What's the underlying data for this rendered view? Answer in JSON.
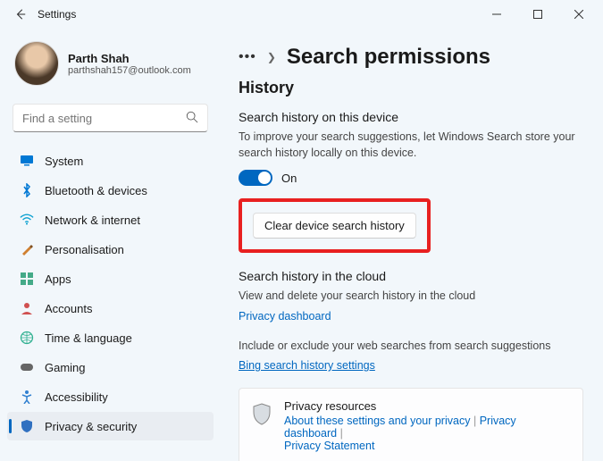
{
  "window": {
    "title": "Settings"
  },
  "profile": {
    "name": "Parth Shah",
    "email": "parthshah157@outlook.com"
  },
  "search": {
    "placeholder": "Find a setting"
  },
  "sidebar": {
    "items": [
      {
        "label": "System"
      },
      {
        "label": "Bluetooth & devices"
      },
      {
        "label": "Network & internet"
      },
      {
        "label": "Personalisation"
      },
      {
        "label": "Apps"
      },
      {
        "label": "Accounts"
      },
      {
        "label": "Time & language"
      },
      {
        "label": "Gaming"
      },
      {
        "label": "Accessibility"
      },
      {
        "label": "Privacy & security"
      }
    ]
  },
  "page": {
    "title": "Search permissions",
    "history_heading": "History",
    "device_heading": "Search history on this device",
    "device_desc": "To improve your search suggestions, let Windows Search store your search history locally on this device.",
    "toggle_state": "On",
    "clear_button": "Clear device search history",
    "cloud_heading": "Search history in the cloud",
    "cloud_desc": "View and delete your search history in the cloud",
    "privacy_dashboard": "Privacy dashboard",
    "include_desc": "Include or exclude your web searches from search suggestions",
    "bing_link": "Bing search history settings",
    "card_title": "Privacy resources",
    "card_link1": "About these settings and your privacy",
    "card_link2": "Privacy dashboard",
    "card_link3": "Privacy Statement"
  }
}
